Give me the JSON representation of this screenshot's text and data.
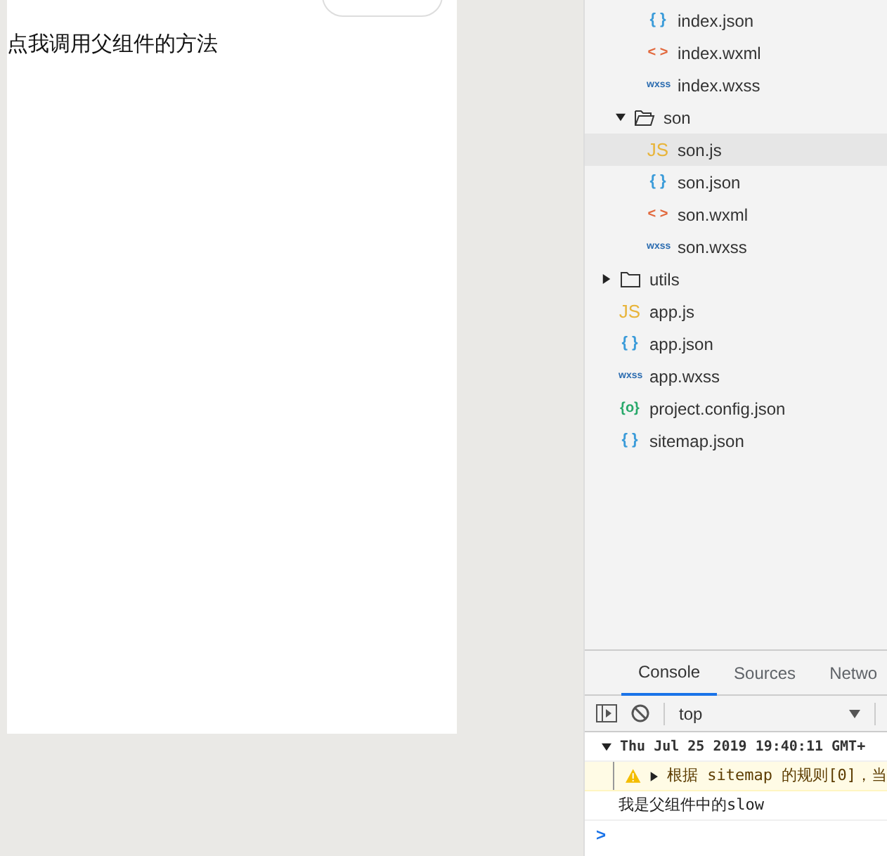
{
  "phone": {
    "button_label": "点我调用父组件的方法"
  },
  "file_tree": [
    {
      "kind": "group",
      "children": [
        {
          "kind": "group",
          "children": [
            {
              "kind": "json",
              "icon": "{ }",
              "label": "index.json",
              "selected": false
            },
            {
              "kind": "wxml",
              "icon": "< >",
              "label": "index.wxml",
              "selected": false
            },
            {
              "kind": "wxss",
              "icon": "wxss",
              "label": "index.wxss",
              "selected": false
            }
          ]
        },
        {
          "kind": "folder",
          "label": "son",
          "expanded": true,
          "selected": false,
          "children": [
            {
              "kind": "js",
              "icon": "JS",
              "label": "son.js",
              "selected": true
            },
            {
              "kind": "json",
              "icon": "{ }",
              "label": "son.json",
              "selected": false
            },
            {
              "kind": "wxml",
              "icon": "< >",
              "label": "son.wxml",
              "selected": false
            },
            {
              "kind": "wxss",
              "icon": "wxss",
              "label": "son.wxss",
              "selected": false
            }
          ]
        }
      ]
    },
    {
      "kind": "folder",
      "label": "utils",
      "expanded": false,
      "selected": false
    },
    {
      "kind": "js",
      "icon": "JS",
      "label": "app.js",
      "selected": false
    },
    {
      "kind": "json",
      "icon": "{ }",
      "label": "app.json",
      "selected": false
    },
    {
      "kind": "wxss",
      "icon": "wxss",
      "label": "app.wxss",
      "selected": false
    },
    {
      "kind": "config",
      "icon": "{o}",
      "label": "project.config.json",
      "selected": false
    },
    {
      "kind": "json",
      "icon": "{ }",
      "label": "sitemap.json",
      "selected": false
    }
  ],
  "devtools": {
    "tabs": [
      {
        "label": "Console",
        "selected": true
      },
      {
        "label": "Sources",
        "selected": false
      },
      {
        "label": "Netwo",
        "selected": false
      }
    ],
    "context": "top",
    "messages": [
      {
        "kind": "group",
        "text": "Thu Jul 25 2019 19:40:11 GMT+",
        "expanded": true
      },
      {
        "kind": "warning",
        "text": "根据 sitemap 的规则[0]，当"
      },
      {
        "kind": "log",
        "text": "我是父组件中的slow"
      }
    ],
    "prompt": ">"
  }
}
